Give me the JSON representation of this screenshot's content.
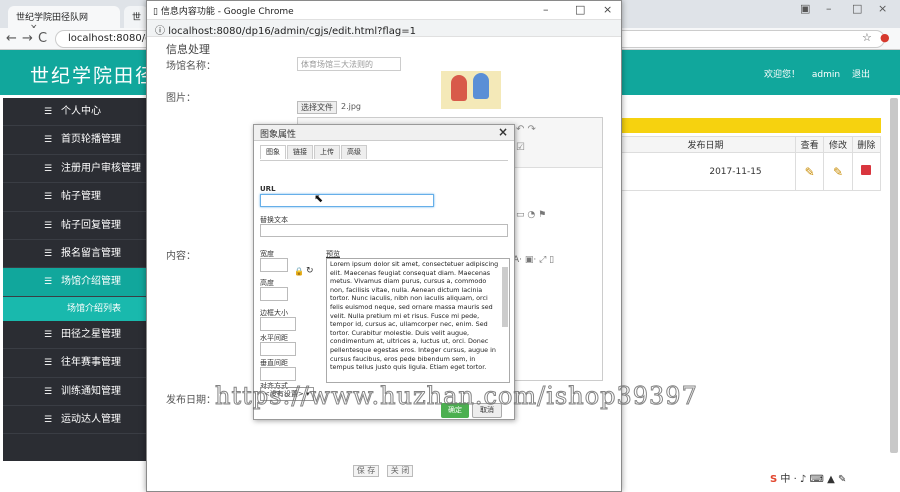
{
  "browser_bg": {
    "tabs": [
      {
        "label": "世纪学院田径队网",
        "close": "×"
      },
      {
        "label": "世",
        "close": ""
      }
    ],
    "window_controls": [
      "–",
      "□",
      "×"
    ],
    "address": "localhost:8080/dp1",
    "nav": {
      "back": "←",
      "forward": "→",
      "reload": "C"
    }
  },
  "site": {
    "title": "世纪学院田径",
    "welcome": "欢迎您！",
    "user": "admin",
    "logout": "退出"
  },
  "sidebar": {
    "items": [
      {
        "label": "个人中心"
      },
      {
        "label": "首页轮播管理"
      },
      {
        "label": "注册用户审核管理"
      },
      {
        "label": "帖子管理"
      },
      {
        "label": "帖子回复管理"
      },
      {
        "label": "报名留言管理"
      },
      {
        "label": "场馆介绍管理",
        "active": true
      },
      {
        "label": "田径之星管理"
      },
      {
        "label": "往年赛事管理"
      },
      {
        "label": "训练通知管理"
      },
      {
        "label": "运动达人管理"
      }
    ],
    "sub_item": "场馆介绍列表"
  },
  "table": {
    "headers": [
      "发布日期",
      "查看",
      "修改",
      "删除"
    ],
    "rows": [
      {
        "date": "2017-11-15"
      }
    ]
  },
  "popup": {
    "window_title": "信息内容功能 - Google Chrome",
    "window_controls": [
      "–",
      "□",
      "×"
    ],
    "url": "localhost:8080/dp16/admin/cgjs/edit.html?flag=1",
    "heading": "信息处理",
    "name_label": "场馆名称：",
    "name_value": "体育场馆三大法则的",
    "image_label": "图片：",
    "file_button": "选择文件",
    "file_name": "2.jpg",
    "content_label": "内容：",
    "date_label": "发布日期：",
    "save_button": "保 存",
    "close_button": "关 闭"
  },
  "dialog": {
    "title": "图象属性",
    "close": "×",
    "tabs": [
      "图象",
      "链接",
      "上传",
      "高级"
    ],
    "url_label": "URL",
    "url_value": "",
    "alt_label": "替换文本",
    "width_label": "宽度",
    "height_label": "高度",
    "border_label": "边框大小",
    "hspace_label": "水平间距",
    "vspace_label": "垂直间距",
    "align_label": "对齐方式",
    "align_value": "<没有设置>",
    "preview_label": "预览",
    "preview_text": "Lorem ipsum dolor sit amet, consectetuer adipiscing elit. Maecenas feugiat consequat diam. Maecenas metus. Vivamus diam purus, cursus a, commodo non, facilisis vitae, nulla. Aenean dictum lacinia tortor. Nunc iaculis, nibh non iaculis aliquam, orci felis euismod neque, sed ornare massa mauris sed velit. Nulla pretium mi et risus. Fusce mi pede, tempor id, cursus ac, ullamcorper nec, enim. Sed tortor. Curabitur molestie. Duis velit augue, condimentum at, ultrices a, luctus ut, orci. Donec pellentesque egestas eros. Integer cursus, augue in cursus faucibus, eros pede bibendum sem, in tempus tellus justo quis ligula. Etiam eget tortor.",
    "ok": "确定",
    "cancel": "取消"
  },
  "watermark": "https://www.huzhan.com/ishop39397",
  "icons": {
    "menu": "menu-stack-icon",
    "lock": "lock-icon",
    "reset": "reset-icon",
    "pencil": "pencil-icon",
    "delete": "delete-icon"
  },
  "colors": {
    "header_teal": "#11a79c",
    "sidebar_dark": "#2b2d33",
    "notice_yellow": "#f6d20f",
    "ok_green": "#4caf50"
  }
}
